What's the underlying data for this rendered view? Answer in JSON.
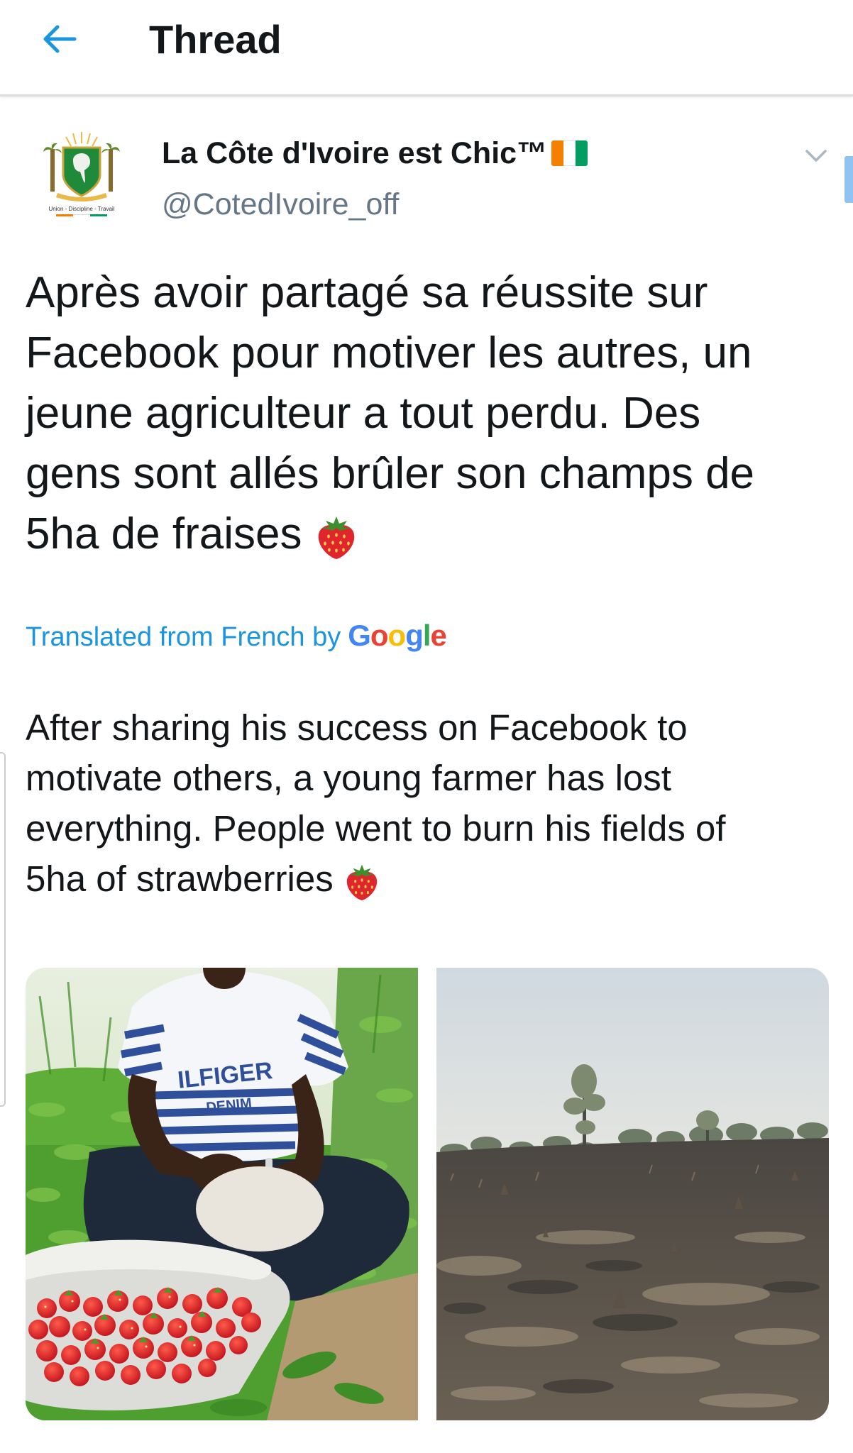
{
  "header": {
    "title": "Thread",
    "back_icon": "back-arrow-icon",
    "accent_color": "#1b95e0"
  },
  "tweet": {
    "author": {
      "display_name": "La Côte d'Ivoire est Chic™",
      "handle": "@CotedIvoire_off",
      "avatar_motto": "Union - Discipline - Travail",
      "flag_colors": [
        "#f77f00",
        "#ffffff",
        "#009e60"
      ]
    },
    "text_lines": [
      "Après avoir partagé sa réussite sur",
      "Facebook pour motiver les autres, un",
      "jeune agriculteur a tout perdu. Des",
      "gens sont allés brûler son champs de",
      "5ha de fraises"
    ],
    "translation": {
      "label": "Translated from French by",
      "provider": "Google",
      "provider_letters": [
        "G",
        "o",
        "o",
        "g",
        "l",
        "e"
      ],
      "provider_colors": [
        "#4285f4",
        "#ea4335",
        "#fbbc05",
        "#4285f4",
        "#34a853",
        "#ea4335"
      ]
    },
    "translated_lines": [
      "After sharing his success on Facebook to",
      "motivate others, a young farmer has lost",
      "everything. People went to burn his fields of",
      "5ha of strawberries"
    ],
    "media": [
      {
        "shirt_text_1": "ILFIGER",
        "shirt_text_2": "DENIM"
      },
      {}
    ]
  }
}
